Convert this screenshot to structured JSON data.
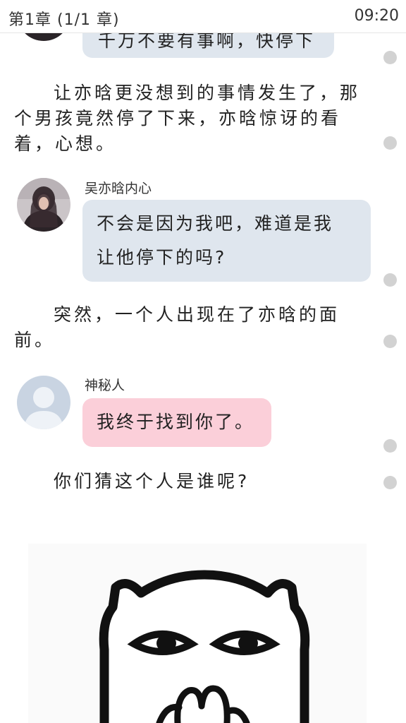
{
  "status_bar": {
    "chapter": "第1章 (1/1 章)",
    "time": "09:20"
  },
  "messages": [
    {
      "text": "千万不要有事啊，快停下"
    },
    {
      "narration": "让亦晗更没想到的事情发生了，那个男孩竟然停了下来，亦晗惊讶的看着，心想。"
    },
    {
      "speaker": "吴亦晗内心",
      "line1": "不会是因为我吧，难道是我",
      "line2": "让他停下的吗?"
    },
    {
      "narration": "突然，一个人出现在了亦晗的面前。"
    },
    {
      "speaker": "神秘人",
      "text": "我终于找到你了。"
    },
    {
      "narration": "你们猜这个人是谁呢?"
    }
  ],
  "icons": {
    "avatar_girl": "girl-photo-avatar",
    "avatar_mystery": "default-person-avatar",
    "sticker": "cartoon-cat-face-sticker",
    "comment_dot": "paragraph-comment-dot"
  },
  "colors": {
    "bubble_blue": "#dfe6ee",
    "bubble_pink": "#fbcfd9",
    "dot_gray": "#d2d2d2",
    "text": "#222222"
  }
}
